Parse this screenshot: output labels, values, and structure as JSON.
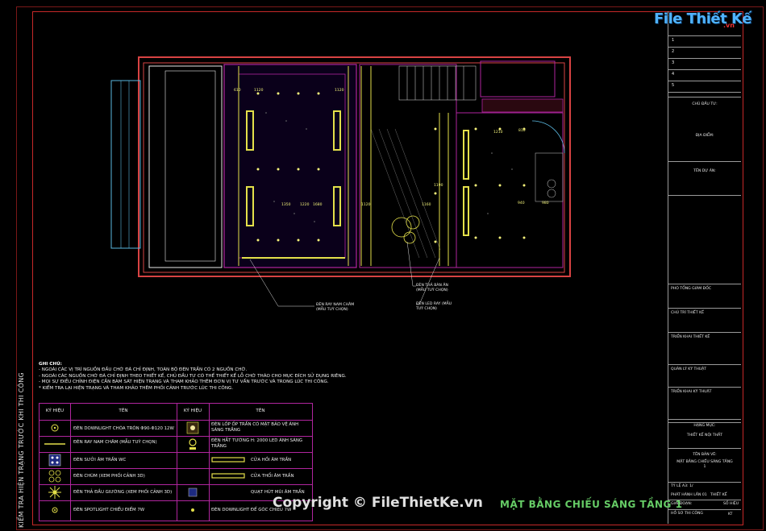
{
  "logo": {
    "main": "File Thiết Kế",
    "sub": ".vn"
  },
  "copyright": "Copyright © FileThietKe.vn",
  "sheet_title": "MẶT BẰNG CHIẾU SÁNG TẦNG 1",
  "vertical_title": "KIỂM TRA HIỆN TRẠNG TRƯỚC KHI THI CÔNG",
  "notes": {
    "heading": "GHI CHÚ:",
    "lines": [
      "- NGOÀI CÁC VỊ TRÍ NGUỒN ĐẦU CHỜ ĐÃ CHỈ ĐỊNH, TOÀN BỘ ĐÈN TRẦN CÓ 2 NGUỒN CHỜ.",
      "- NGOÀI CÁC NGUỒN CHỜ ĐÃ CHỈ ĐỊNH THEO THIẾT KẾ, CHỦ ĐẦU TƯ CÓ THỂ THIẾT KẾ LỖ CHỜ THÁO CHO MỤC ĐÍCH SỬ DỤNG RIÊNG.",
      "- MỌI SỰ ĐIỀU CHỈNH ĐIỆN CẦN BÁM SÁT HIỆN TRẠNG VÀ THAM KHẢO THÊM ĐƠN VỊ TƯ VẤN TRƯỚC VÀ TRONG LÚC THI CÔNG.",
      "* KIỂM TRA LẠI HIỆN TRẠNG VÀ THAM KHẢO THÊM PHỐI CẢNH TRƯỚC LÚC THI CÔNG."
    ]
  },
  "legend": {
    "headers": [
      "KÝ HIỆU",
      "TÊN",
      "KÝ HIỆU",
      "TÊN"
    ],
    "rows": [
      {
        "left": "ĐÈN DOWNLIGHT CHÓA TRÒN Φ90-Φ120 12W",
        "right": "ĐÈN LỐP ỐP TRẦN CÓ MẶT BẢO VỆ ÁNH SÁNG TRẮNG"
      },
      {
        "left": "ĐÈN RAY NAM CHÂM (MẪU TUỲ CHỌN)",
        "right": "ĐÈN HẮT TƯỜNG H: 2000 LED ÁNH SÁNG TRẮNG"
      },
      {
        "left": "ĐÈN SƯỞI ÂM TRẦN WC",
        "right": "CỬA HỒI ÂM TRẦN"
      },
      {
        "left": "ĐÈN CHÙM (XEM PHỐI CẢNH 3D)",
        "right": "CỬA THỔI ÂM TRẦN"
      },
      {
        "left": "ĐÈN THẢ ĐẦU GIƯỜNG (XEM PHỐI CẢNH 3D)",
        "right": "QUẠT HÚT MÙI ÂM TRẦN"
      },
      {
        "left": "ĐÈN SPOTLIGHT CHIẾU ĐIỂM 7W",
        "right": "ĐÈN DOWNLIGHT ĐỂ GÓC CHIẾU 7W"
      }
    ]
  },
  "callouts": {
    "magnet": "ĐÈN RAY NAM CHÂM (MẪU TUỲ CHỌN)",
    "pendant": "ĐÈN THẢ BÀN ĂN (MẪU TUỲ CHỌN)",
    "led": "ĐÈN LED RAY (MẪU TUỲ CHỌN)"
  },
  "title_block": {
    "revisions": [
      "1",
      "2",
      "3",
      "4",
      "5"
    ],
    "owner": "CHỦ ĐẦU TƯ:",
    "address": "ĐỊA ĐIỂM:",
    "project": "TÊN DỰ ÁN:",
    "director": "PHÓ TỔNG GIÁM ĐỐC",
    "lead": "CHỦ TRÌ THIẾT KẾ",
    "designer": "TRIỂN KHAI THIẾT KẾ",
    "qc": "QUẢN LÝ KỸ THUẬT",
    "tech": "TRIỂN KHAI KỸ THUẬT",
    "category_label": "HẠNG MỤC:",
    "category_value": "THIẾT KẾ NỘI THẤT",
    "drawing_label": "TÊN BẢN VẼ:",
    "drawing_value": "MẶT BẰNG CHIẾU SÁNG TẦNG 1",
    "scale": "TỶ LỆ A3: 1/",
    "phase": "PHÁT HÀNH LẦN 01",
    "stage_label": "GIAI ĐOẠN:",
    "stage_value": "THIẾT KẾ",
    "dossier": "HỒ SƠ THI CÔNG",
    "sheet_no_label": "SỐ HIỆU",
    "sheet_no": "KT"
  },
  "plan_labels": [
    "610",
    "1120",
    "1120",
    "1220",
    "1350",
    "1680",
    "1120",
    "1160",
    "810",
    "1190",
    "1210",
    "940",
    "980"
  ],
  "colors": {
    "frame": "#c62828",
    "wall": "#d84343",
    "magenta": "#b0259e",
    "yellow": "#e4e04a",
    "title_green": "#66cc66"
  }
}
